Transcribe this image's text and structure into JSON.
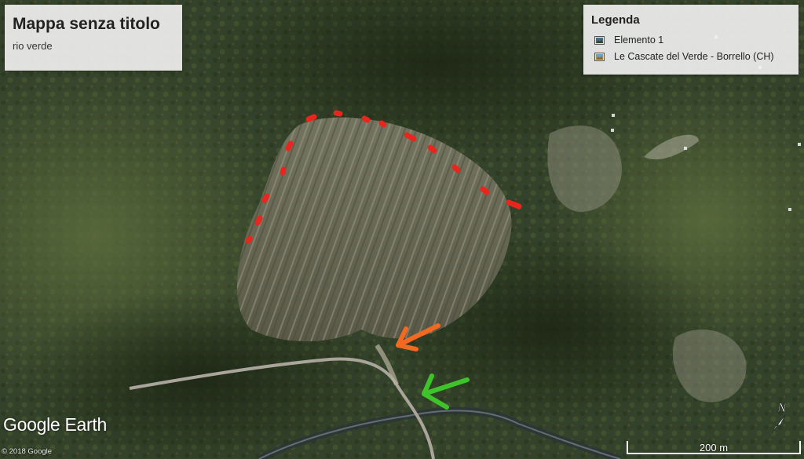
{
  "title_panel": {
    "title": "Mappa senza titolo",
    "subtitle": "rio verde"
  },
  "legend": {
    "heading": "Legenda",
    "items": [
      {
        "label": "Elemento 1",
        "icon": "image-placemark-icon"
      },
      {
        "label": "Le Cascate del Verde - Borrello (CH)",
        "icon": "photo-placemark-icon"
      }
    ]
  },
  "branding": {
    "logo": "Google Earth",
    "copyright": "© 2018 Google"
  },
  "scale": {
    "label": "200 m"
  },
  "compass": {
    "label": "N"
  },
  "annotations": {
    "dotted_arc_color": "#e8261e",
    "orange_arrow_color": "#f26a21",
    "green_arrow_color": "#3ec42a"
  }
}
